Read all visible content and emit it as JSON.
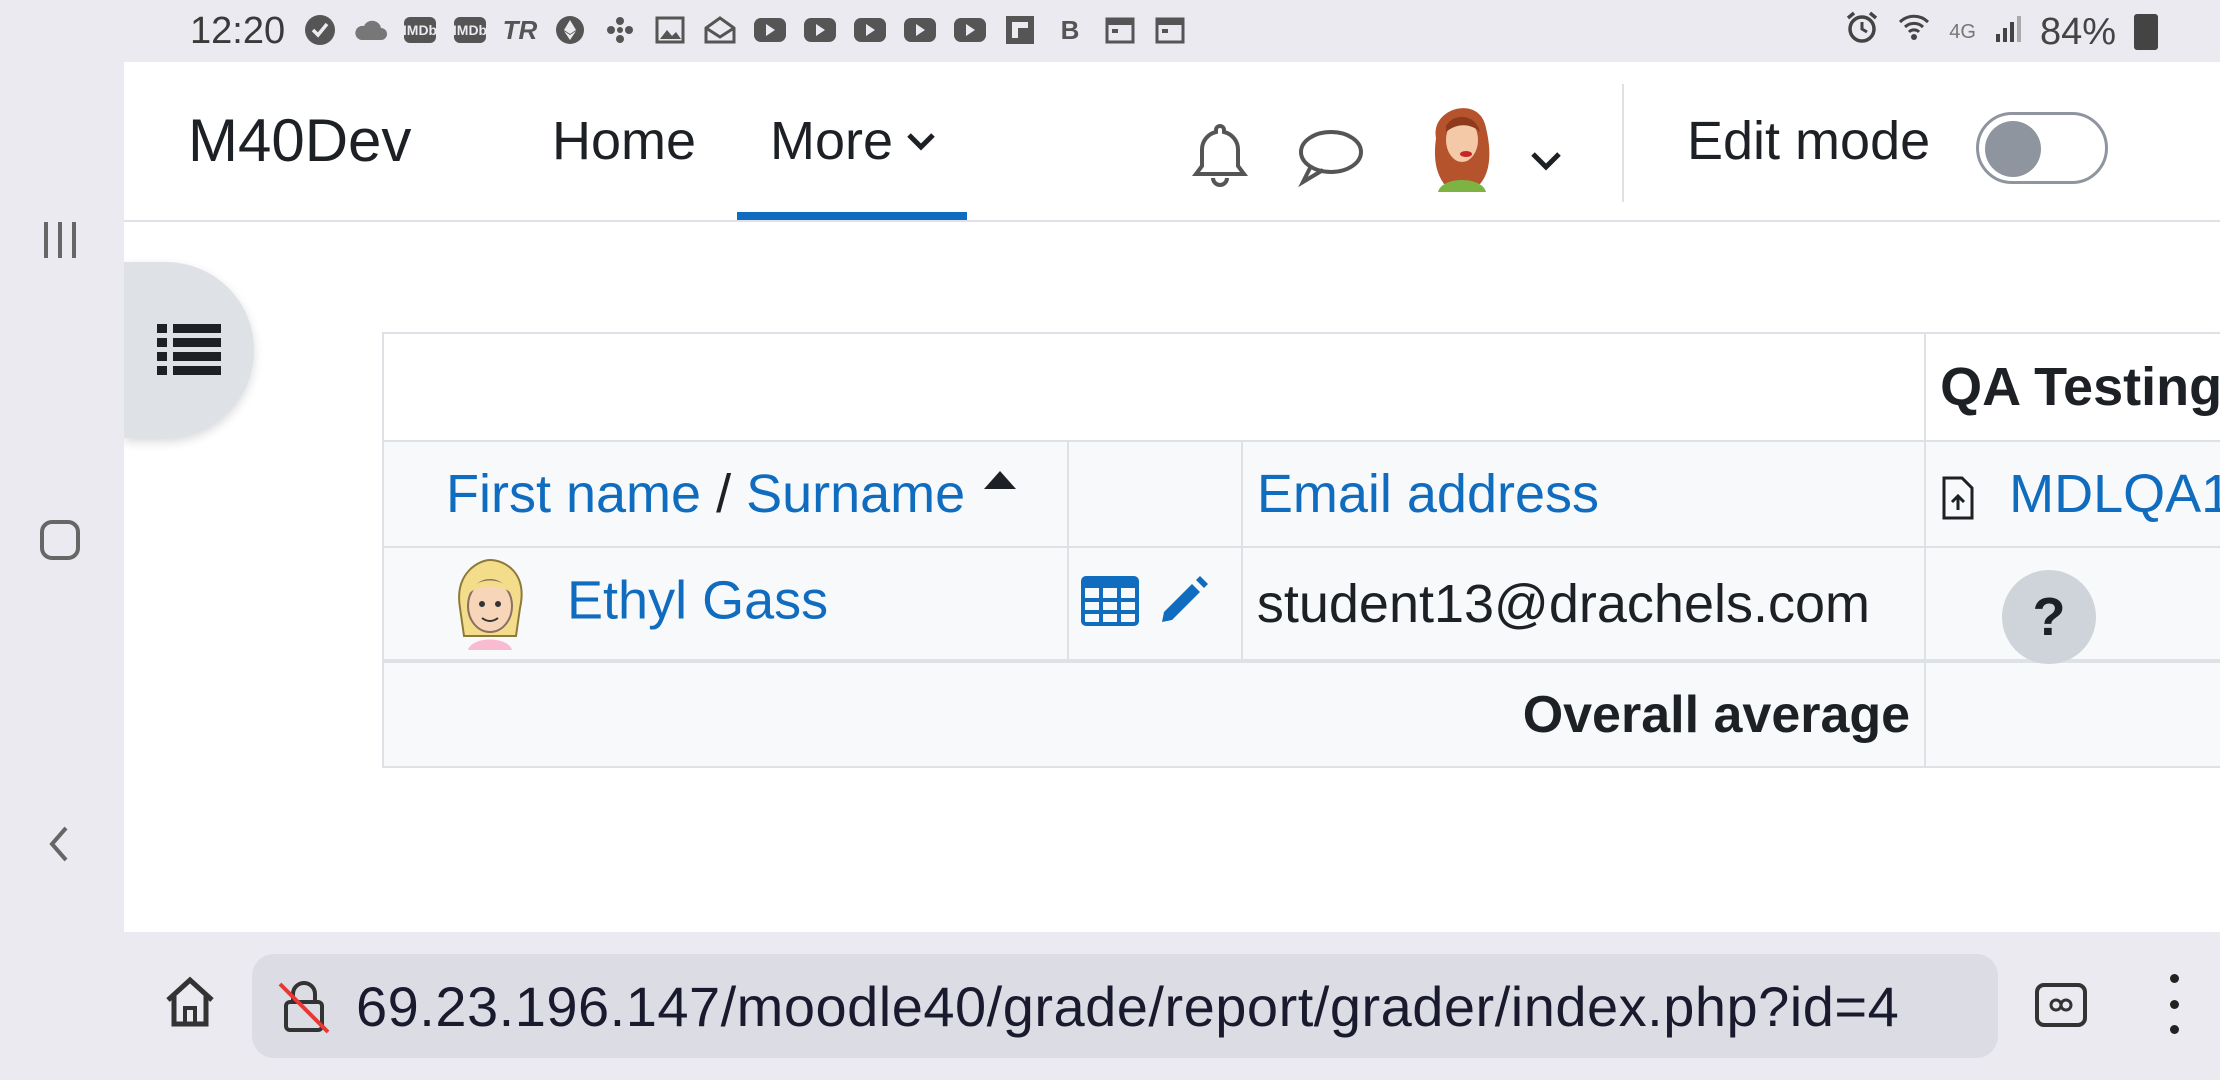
{
  "statusbar": {
    "time": "12:20",
    "battery": "84%",
    "left_icons": [
      "check-circle-icon",
      "cloud-icon",
      "imdb-icon",
      "imdb-icon",
      "tr-icon",
      "ethereum-icon",
      "fan-icon",
      "image-icon",
      "mail-icon",
      "youtube-icon",
      "youtube-icon",
      "youtube-icon",
      "youtube-icon",
      "youtube-icon",
      "flipboard-icon",
      "bold-b-icon",
      "calendar-icon",
      "calendar-icon"
    ],
    "right_icons": [
      "alarm-icon",
      "wifi-icon",
      "4g-icon",
      "signal-icon",
      "battery-icon"
    ],
    "network": "4G"
  },
  "site": {
    "brand": "M40Dev",
    "nav": {
      "home": "Home",
      "more": "More"
    },
    "edit_mode_label": "Edit mode",
    "edit_mode_on": false
  },
  "grader": {
    "category_title": "QA Testing",
    "headers": {
      "first_name": "First name",
      "separator": " / ",
      "surname": "Surname",
      "email": "Email address",
      "item": "MDLQA1"
    },
    "students": [
      {
        "name": "Ethyl Gass",
        "email": "student13@drachels.com"
      }
    ],
    "overall_average_label": "Overall average"
  },
  "help": {
    "label": "?"
  },
  "browser": {
    "url": "69.23.196.147/moodle40/grade/report/grader/index.php?id=4"
  },
  "colors": {
    "link": "#0f6cbf",
    "text": "#1d2125",
    "chrome_bg": "#eaeaf0",
    "border": "#dee2e6"
  }
}
